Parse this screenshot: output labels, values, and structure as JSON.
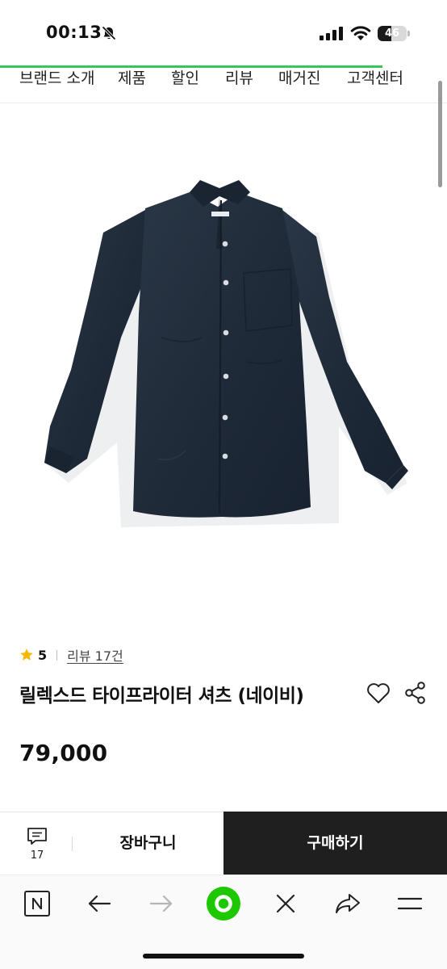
{
  "status_bar": {
    "time": "00:13",
    "battery": "46",
    "battery_level": 0.46
  },
  "nav": {
    "items": [
      "브랜드 소개",
      "제품",
      "할인",
      "리뷰",
      "매거진",
      "고객센터"
    ],
    "accent_color": "#35c759"
  },
  "product": {
    "image_icon": "navy-shirt-image",
    "rating": "5",
    "review_link": "리뷰 17건",
    "title": "릴렉스드 타이프라이터 셔츠 (네이비)",
    "price": "79,000"
  },
  "action_bar": {
    "chat_count": "17",
    "cart_label": "장바구니",
    "buy_label": "구매하기"
  },
  "browser_toolbar": {
    "icons": [
      "naver-n-icon",
      "back-arrow-icon",
      "forward-arrow-icon",
      "green-home-icon",
      "close-icon",
      "share-arrow-icon",
      "menu-icon"
    ],
    "accent_color": "#1ec800"
  }
}
